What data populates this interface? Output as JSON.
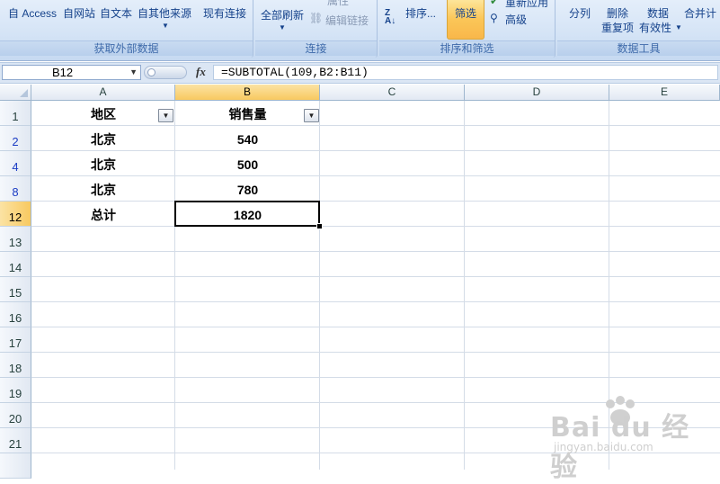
{
  "ribbon": {
    "get_external_data": {
      "label": "获取外部数据",
      "items": [
        "自 Access",
        "自网站",
        "自文本",
        "自其他来源",
        "现有连接"
      ]
    },
    "connections": {
      "label": "连接",
      "refresh_all": "全部刷新",
      "properties": "属性",
      "edit_links": "编辑链接"
    },
    "sort_filter": {
      "label": "排序和筛选",
      "sort": "排序...",
      "filter": "筛选",
      "reapply": "重新应用",
      "advanced": "高级"
    },
    "data_tools": {
      "label": "数据工具",
      "split": "分列",
      "remove_dup_1": "删除",
      "remove_dup_2": "重复项",
      "validation_1": "数据",
      "validation_2": "有效性",
      "consolidate": "合并计"
    }
  },
  "formula_bar": {
    "name_box": "B12",
    "formula": "=SUBTOTAL(109,B2:B11)"
  },
  "columns": [
    "A",
    "B",
    "C",
    "D",
    "E"
  ],
  "rows": [
    "1",
    "2",
    "4",
    "8",
    "12",
    "13",
    "14",
    "15",
    "16",
    "17",
    "18",
    "19",
    "20",
    "21"
  ],
  "cells": {
    "A1": "地区",
    "B1": "销售量",
    "A2": "北京",
    "B2": "540",
    "A4": "北京",
    "B4": "500",
    "A8": "北京",
    "B8": "780",
    "A12": "总计",
    "B12": "1820"
  },
  "watermark": {
    "brand": "Bai du 经验",
    "url": "jingyan.baidu.com"
  },
  "colors": {
    "selected_header": "#f8c960",
    "filtered_row_number": "#1b3cc4",
    "ribbon_text": "#15428b"
  }
}
